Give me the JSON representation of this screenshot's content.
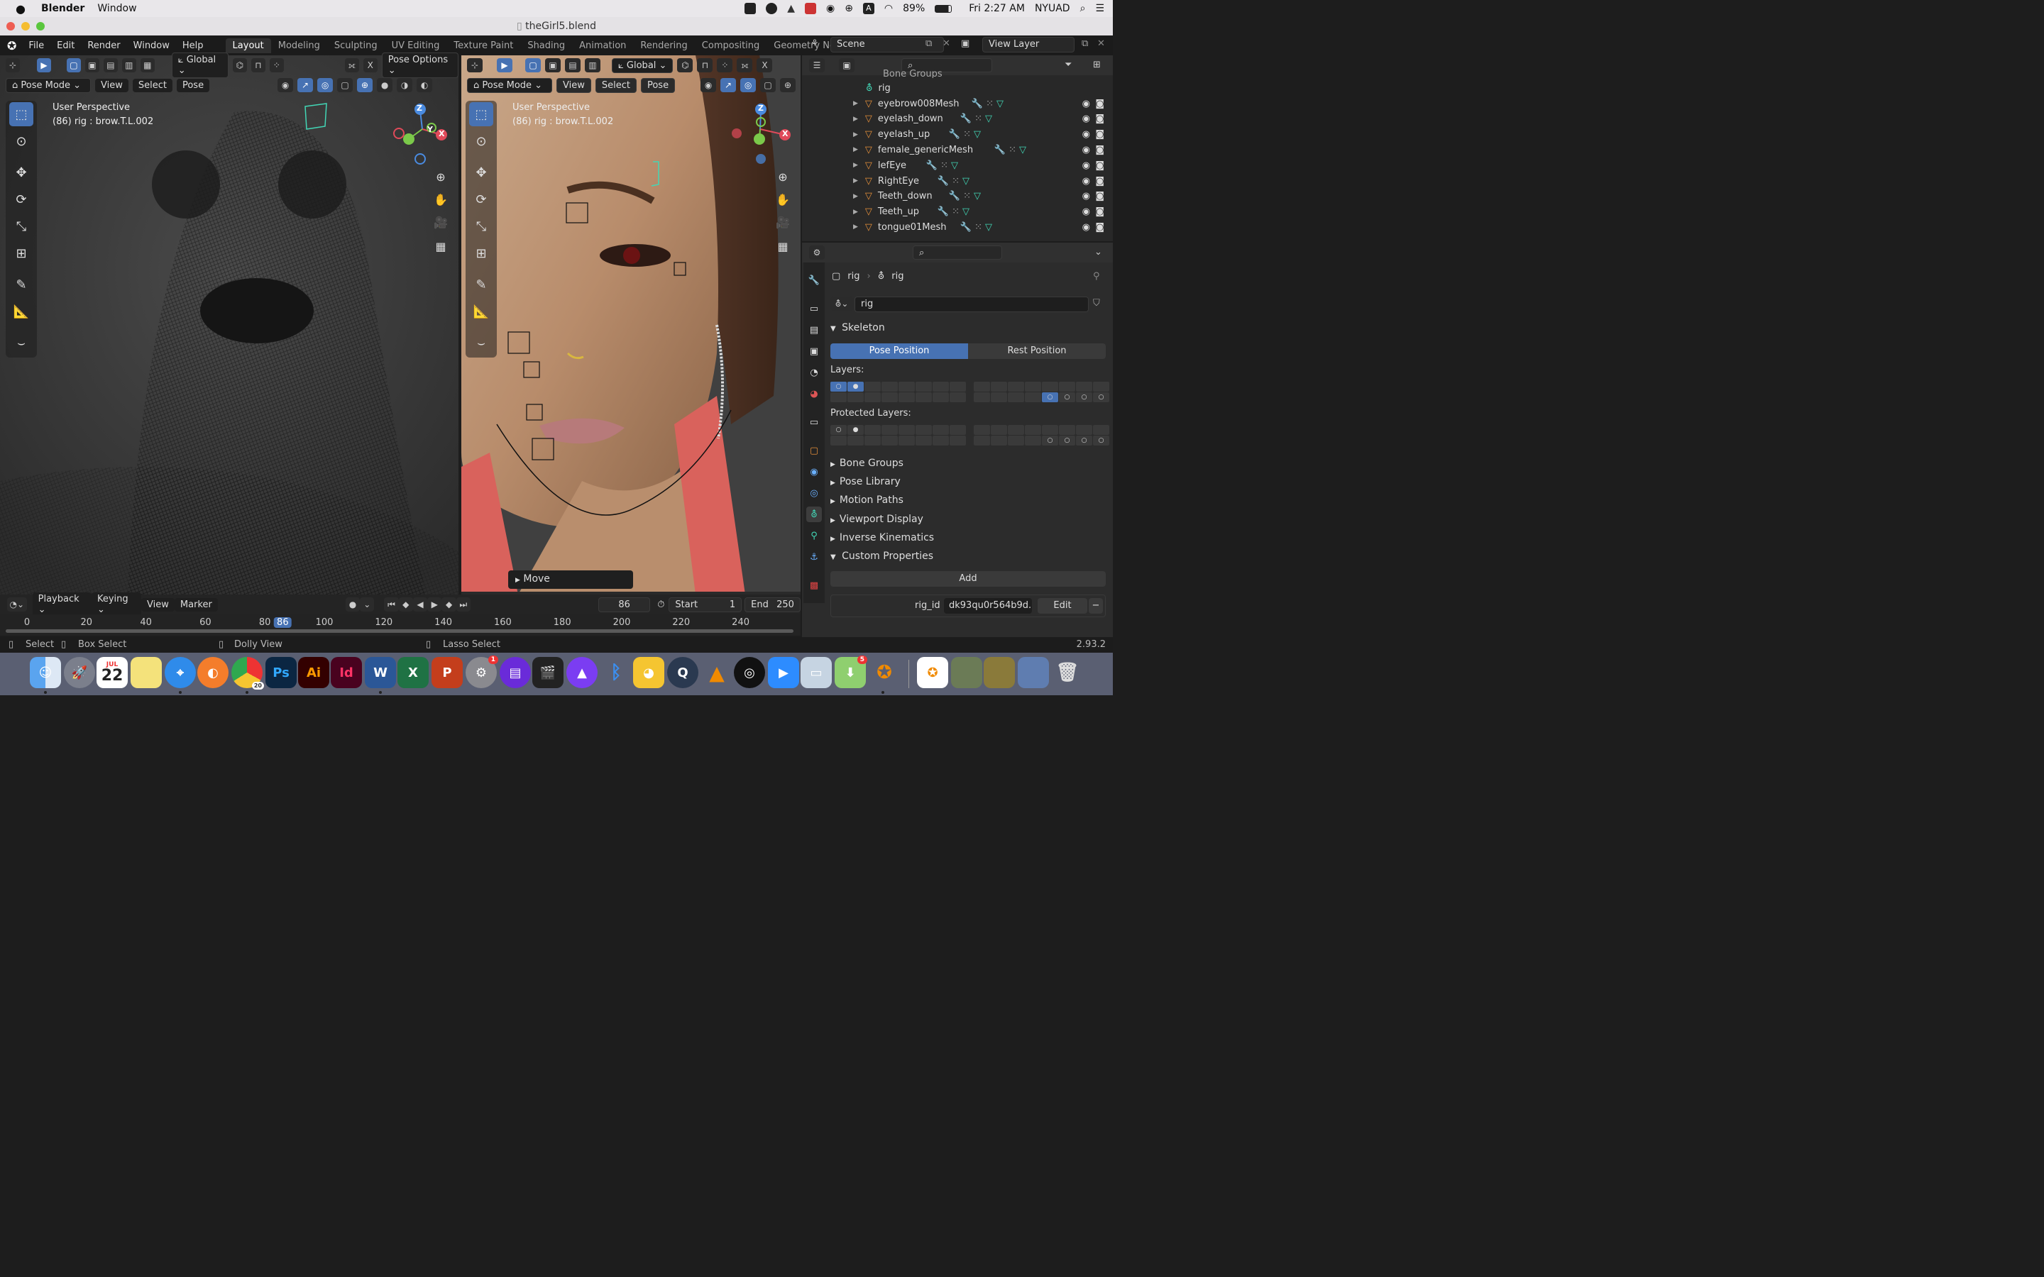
{
  "menubar": {
    "app_name": "Blender",
    "items": [
      "Window"
    ],
    "battery": "89%",
    "clock": "Fri 2:27 AM",
    "user": "NYUAD"
  },
  "window": {
    "title": "theGirl5.blend"
  },
  "topbar": {
    "menus": [
      "File",
      "Edit",
      "Render",
      "Window",
      "Help"
    ],
    "workspaces": [
      "Layout",
      "Modeling",
      "Sculpting",
      "UV Editing",
      "Texture Paint",
      "Shading",
      "Animation",
      "Rendering",
      "Compositing",
      "Geometry Nodes"
    ],
    "active_workspace": "Layout",
    "scene": "Scene",
    "view_layer": "View Layer"
  },
  "viewport_left": {
    "orientation": "Global",
    "pose_options": "Pose Options",
    "mode": "Pose Mode",
    "menus": [
      "View",
      "Select",
      "Pose"
    ],
    "overlay_title": "User Perspective",
    "overlay_subtitle": "(86) rig : brow.T.L.002"
  },
  "viewport_right": {
    "orientation": "Global",
    "mode": "Pose Mode",
    "menus": [
      "View",
      "Select",
      "Pose"
    ],
    "overlay_title": "User Perspective",
    "overlay_subtitle": "(86) rig : brow.T.L.002",
    "last_op": "Move"
  },
  "gizmo": {
    "x": "X",
    "y": "Y",
    "z": "Z"
  },
  "outliner": {
    "partial_row": "Bone Groups",
    "rig": "rig",
    "rows": [
      "eyebrow008Mesh",
      "eyelash_down",
      "eyelash_up",
      "female_genericMesh",
      "lefEye",
      "RightEye",
      "Teeth_down",
      "Teeth_up",
      "tongue01Mesh"
    ]
  },
  "properties": {
    "breadcrumb_1": "rig",
    "breadcrumb_2": "rig",
    "data_name": "rig",
    "skeleton_label": "Skeleton",
    "pose_position": "Pose Position",
    "rest_position": "Rest Position",
    "layers_label": "Layers:",
    "protected_label": "Protected Layers:",
    "collapsed_panels": [
      "Bone Groups",
      "Pose Library",
      "Motion Paths",
      "Viewport Display",
      "Inverse Kinematics"
    ],
    "custom_props_label": "Custom Properties",
    "add_label": "Add",
    "prop_key": "rig_id",
    "prop_value": "dk93qu0r564b9d...",
    "edit_label": "Edit"
  },
  "timeline": {
    "menus": [
      "Playback",
      "Keying",
      "View",
      "Marker"
    ],
    "current_frame": "86",
    "start_label": "Start",
    "start_value": "1",
    "end_label": "End",
    "end_value": "250",
    "ticks": [
      "0",
      "20",
      "40",
      "60",
      "80",
      "86",
      "100",
      "120",
      "140",
      "160",
      "180",
      "200",
      "220",
      "240"
    ]
  },
  "statusbar": {
    "select": "Select",
    "box_select": "Box Select",
    "dolly": "Dolly View",
    "lasso": "Lasso Select",
    "version": "2.93.2"
  },
  "dock": {
    "calendar_month": "JUL",
    "calendar_day": "22",
    "ps": "Ps",
    "ai": "Ai",
    "id": "Id",
    "chrome_badge": "20",
    "settings_badge": "1",
    "installer_badge": "5"
  },
  "colors": {
    "accent": "#4772b3",
    "blender_bg": "#1d1d1d",
    "mesh_orange": "#e6903a",
    "armature_teal": "#42d7b6"
  }
}
